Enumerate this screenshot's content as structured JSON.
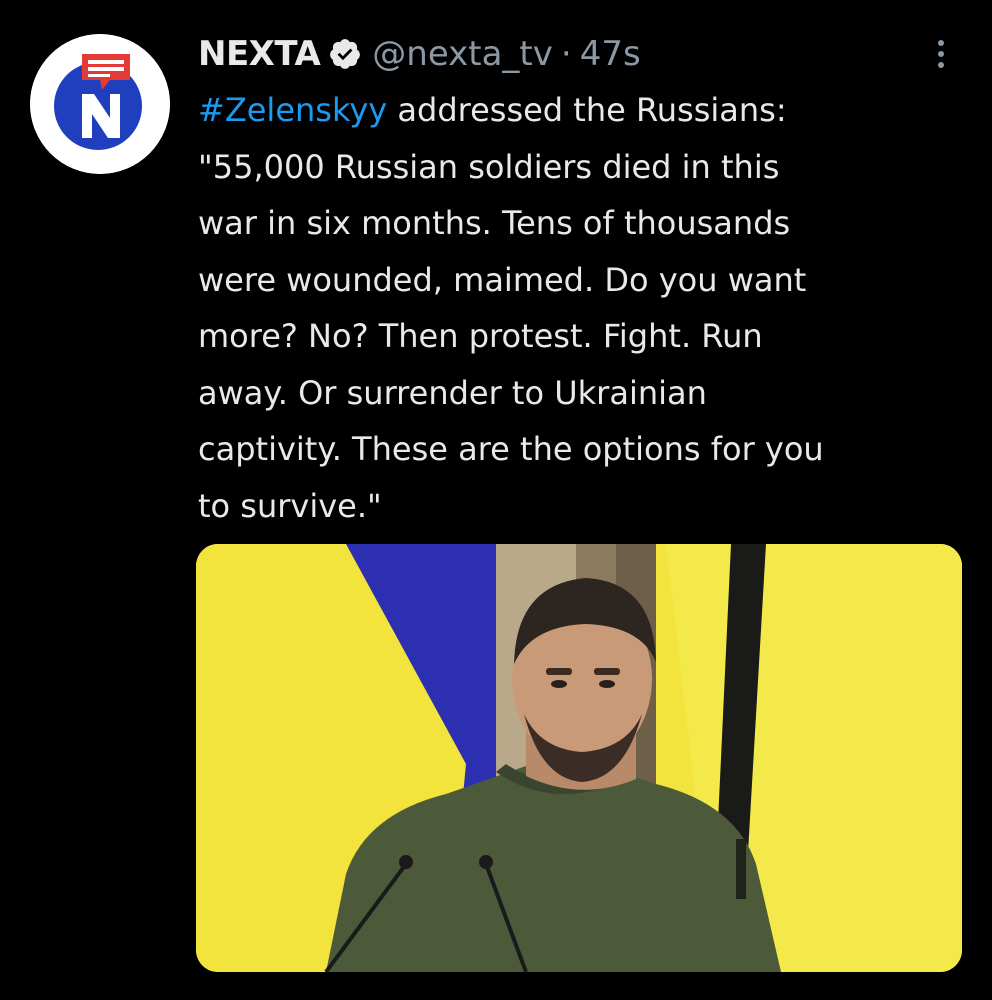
{
  "author": {
    "name": "NEXTA",
    "handle": "@nexta_tv",
    "separator": "·",
    "time": "47s",
    "verified_icon": "verified-badge-icon",
    "avatar_icon": "nexta-logo-icon"
  },
  "tweet": {
    "hashtag": "#Zelenskyy",
    "lines": [
      " addressed the Russians:",
      "\"55,000 Russian soldiers died in this",
      "war in six months. Tens of thousands",
      "were wounded, maimed. Do you want",
      "more? No? Then protest. Fight. Run",
      "away. Or surrender to Ukrainian",
      "captivity. These are the options for you",
      "to survive.\""
    ]
  },
  "media": {
    "type": "photo"
  },
  "colors": {
    "background": "#000000",
    "text": "#e7e9ea",
    "secondary": "#8b98a5",
    "accent": "#1d9bf0",
    "flag_yellow": "#f2e43c",
    "flag_blue": "#2b2fb0"
  },
  "menu": {
    "more_icon": "more-options-icon"
  }
}
